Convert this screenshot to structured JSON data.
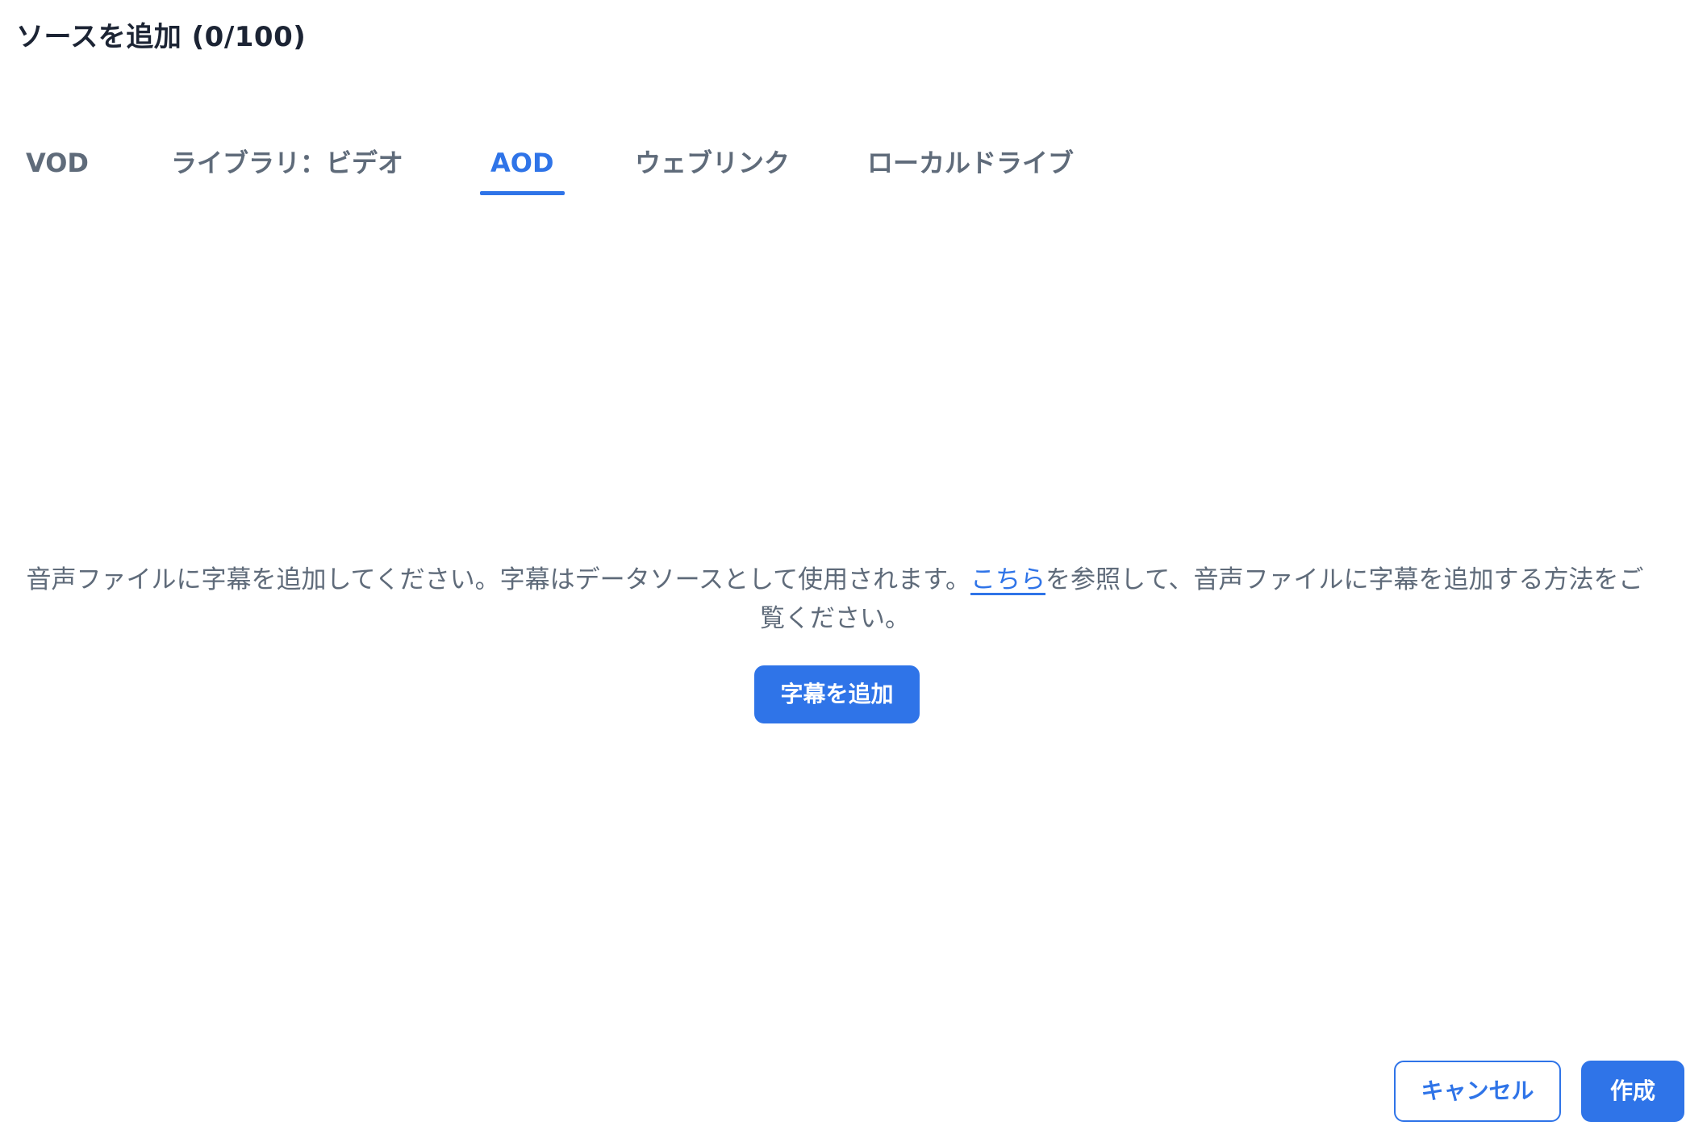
{
  "title": "ソースを追加 (0/100)",
  "tabs": [
    {
      "label": "VOD",
      "active": false
    },
    {
      "label": "ライブラリ：ビデオ",
      "active": false
    },
    {
      "label": "AOD",
      "active": true
    },
    {
      "label": "ウェブリンク",
      "active": false
    },
    {
      "label": "ローカルドライブ",
      "active": false
    }
  ],
  "empty_state": {
    "text_before_link": "音声ファイルに字幕を追加してください。字幕はデータソースとして使用されます。",
    "link_text": "こちら",
    "text_after_link": "を参照して、音声ファイルに字幕を追加する方法をご覧ください。",
    "button_label": "字幕を追加"
  },
  "footer": {
    "cancel_label": "キャンセル",
    "create_label": "作成"
  },
  "colors": {
    "accent": "#2f74e8",
    "text_muted": "#5f6b7a",
    "title_text": "#1c2434"
  }
}
